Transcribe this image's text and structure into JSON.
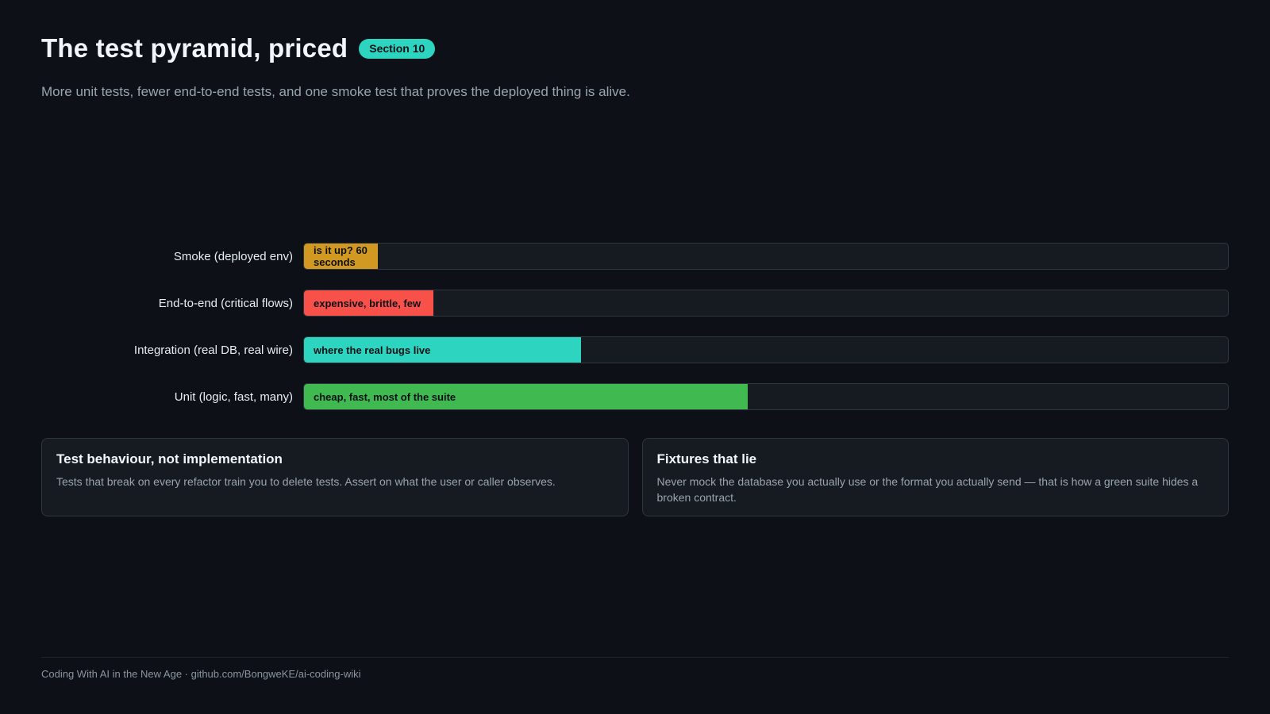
{
  "header": {
    "title": "The test pyramid, priced",
    "badge": "Section 10",
    "subtitle": "More unit tests, fewer end-to-end tests, and one smoke test that proves the deployed thing is alive."
  },
  "chart_data": {
    "type": "bar",
    "orientation": "horizontal",
    "grid": false,
    "categories": [
      "Smoke (deployed env)",
      "End-to-end (critical flows)",
      "Integration (real DB, real wire)",
      "Unit (logic, fast, many)"
    ],
    "values": [
      8,
      14,
      30,
      48
    ],
    "data_labels": [
      "is it up? 60 seconds",
      "expensive, brittle, few",
      "where the real bugs live",
      "cheap, fast, most of the suite"
    ],
    "colors": [
      "#d29922",
      "#f85149",
      "#2dd4bf",
      "#3fb950"
    ],
    "xlim": [
      0,
      100
    ]
  },
  "cards": [
    {
      "title": "Test behaviour, not implementation",
      "body": "Tests that break on every refactor train you to delete tests. Assert on what the user or caller observes."
    },
    {
      "title": "Fixtures that lie",
      "body": "Never mock the database you actually use or the format you actually send — that is how a green suite hides a broken contract."
    }
  ],
  "footer": {
    "text": "Coding With AI in the New Age · github.com/BongweKE/ai-coding-wiki"
  },
  "colors": {
    "background": "#0d1117",
    "accent": "#2dd4bf"
  }
}
